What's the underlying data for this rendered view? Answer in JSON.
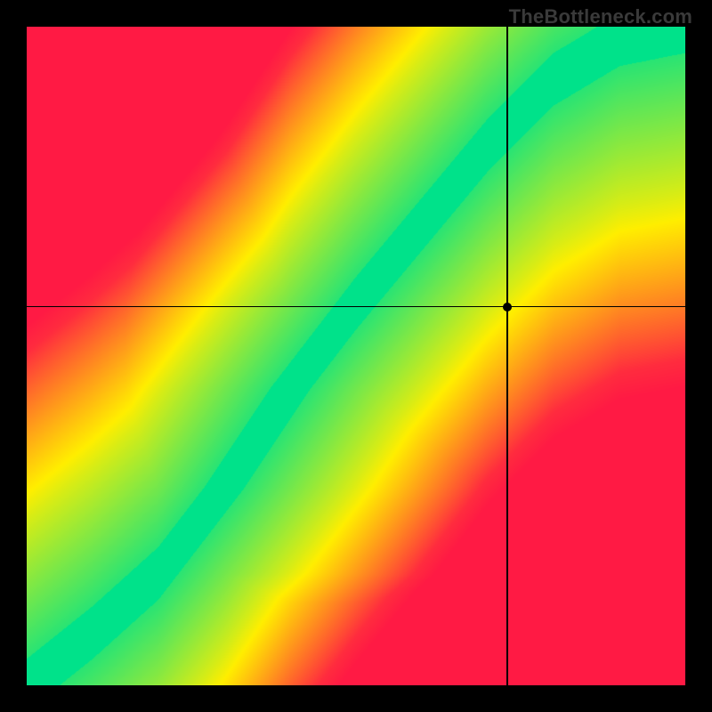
{
  "watermark": "TheBottleneck.com",
  "chart_data": {
    "type": "heatmap",
    "title": "",
    "xlabel": "",
    "ylabel": "",
    "xlim": [
      0,
      1
    ],
    "ylim": [
      0,
      1
    ],
    "crosshair": {
      "x": 0.73,
      "y": 0.575
    },
    "marker": {
      "x": 0.73,
      "y": 0.575
    },
    "colorscale_note": "value 0→red, 0.5→yellow, 1→green; field represents closeness to an ideal diagonal curve",
    "ridge": [
      {
        "x": 0.0,
        "y": 0.0
      },
      {
        "x": 0.1,
        "y": 0.08
      },
      {
        "x": 0.2,
        "y": 0.17
      },
      {
        "x": 0.3,
        "y": 0.3
      },
      {
        "x": 0.4,
        "y": 0.45
      },
      {
        "x": 0.5,
        "y": 0.58
      },
      {
        "x": 0.6,
        "y": 0.7
      },
      {
        "x": 0.7,
        "y": 0.82
      },
      {
        "x": 0.8,
        "y": 0.92
      },
      {
        "x": 0.9,
        "y": 0.98
      },
      {
        "x": 1.0,
        "y": 1.0
      }
    ],
    "ridge_band_halfwidth": 0.04
  }
}
